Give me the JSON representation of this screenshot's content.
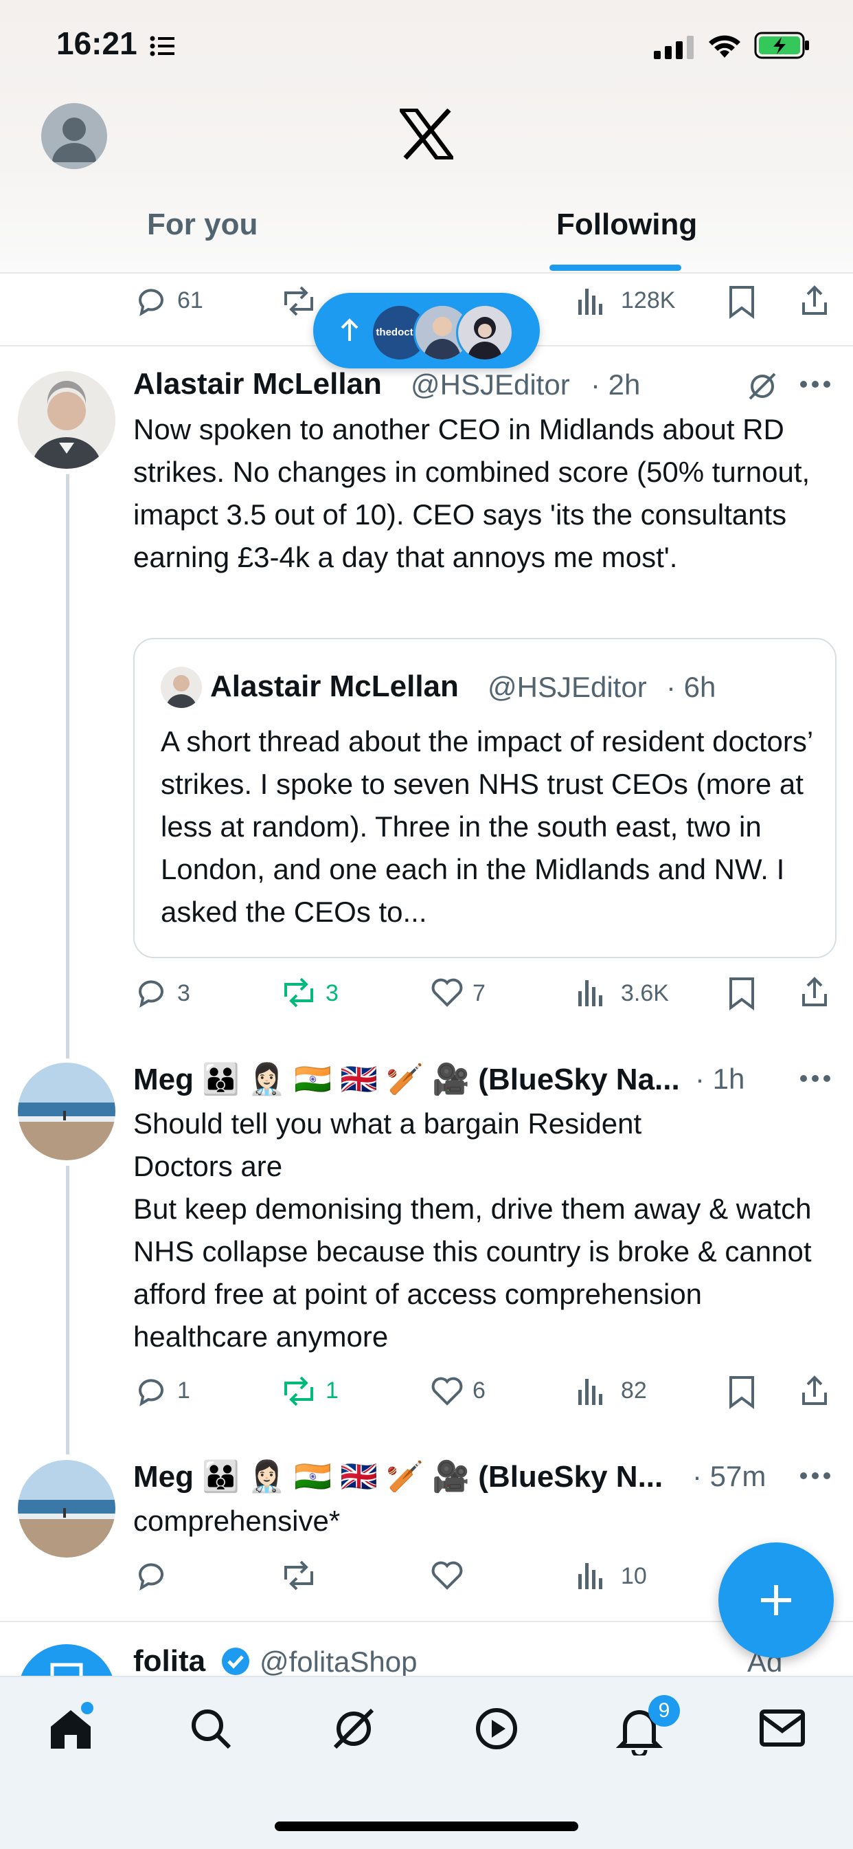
{
  "status_bar": {
    "time": "16:21",
    "battery_percent": 90
  },
  "header": {
    "tabs": [
      {
        "label": "For you",
        "active": false
      },
      {
        "label": "Following",
        "active": true
      }
    ]
  },
  "new_posts_pill": {
    "avatar_label": "thedoctor"
  },
  "top_post_actions": {
    "replies": "61",
    "views": "128K"
  },
  "post1": {
    "name": "Alastair McLellan",
    "handle": "@HSJEditor",
    "time": "· 2h",
    "text": "Now spoken to another CEO in Midlands about RD strikes. No changes in combined score (50% turnout, imapct 3.5 out of 10). CEO says 'its the consultants earning £3-4k a day that annoys me most'.",
    "quote": {
      "name": "Alastair McLellan",
      "handle": "@HSJEditor",
      "time": "· 6h",
      "text": "A short thread about the impact of resident doctors’ strikes. I spoke to seven NHS trust CEOs (more at less at random). Three in the south east, two in London, and one each in the Midlands and NW. I asked the CEOs to..."
    },
    "actions": {
      "replies": "3",
      "reposts": "3",
      "likes": "7",
      "views": "3.6K"
    }
  },
  "post2": {
    "name": "Meg 🧑‍🧑‍🧒 👩🏻‍⚕️ 🇮🇳 🇬🇧 🏏 🎥 (BlueSky Na...",
    "time": "· 1h",
    "text_line1": "Should tell you what a bargain Resident Doctors are",
    "text_line2": "But keep demonising them, drive them away & watch NHS collapse because this country is broke & cannot afford free at point of access comprehension healthcare anymore",
    "actions": {
      "replies": "1",
      "reposts": "1",
      "likes": "6",
      "views": "82"
    }
  },
  "post3": {
    "name": "Meg 🧑‍🧑‍🧒 👩🏻‍⚕️ 🇮🇳 🇬🇧 🏏 🎥 (BlueSky N...",
    "time": "· 57m",
    "text": "comprehensive*",
    "actions": {
      "views": "10"
    }
  },
  "post4": {
    "name": "folita",
    "handle": "@folitaShop",
    "tag": "Ad"
  },
  "bottom_nav": {
    "notifications_badge": "9"
  },
  "colors": {
    "accent": "#1d9bf0",
    "repost_green": "#00ba7c",
    "muted": "#536471"
  }
}
